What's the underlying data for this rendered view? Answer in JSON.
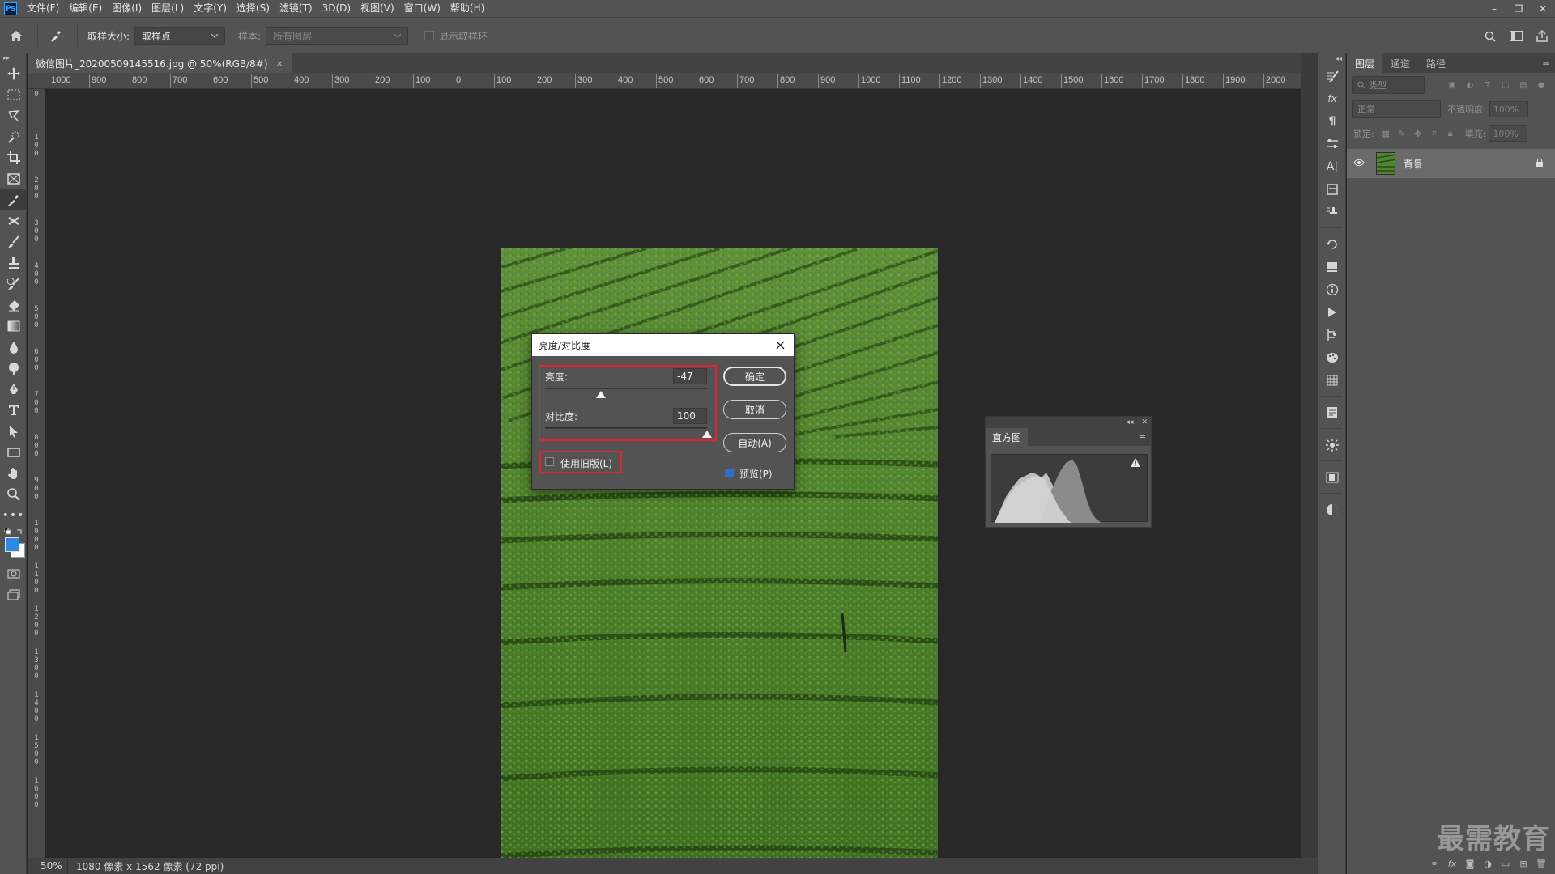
{
  "menubar": {
    "logo": "Ps",
    "items": [
      "文件(F)",
      "编辑(E)",
      "图像(I)",
      "图层(L)",
      "文字(Y)",
      "选择(S)",
      "滤镜(T)",
      "3D(D)",
      "视图(V)",
      "窗口(W)",
      "帮助(H)"
    ],
    "window_controls": [
      "–",
      "❐",
      "✕"
    ]
  },
  "options": {
    "sample_size_label": "取样大小:",
    "sample_size_value": "取样点",
    "sample_label": "样本:",
    "sample_value": "所有图层",
    "show_ring_label": "显示取样环"
  },
  "document": {
    "tab_title": "微信图片_20200509145516.jpg @ 50%(RGB/8#)",
    "tab_close": "×"
  },
  "ruler": {
    "top": [
      "1000",
      "900",
      "800",
      "700",
      "600",
      "500",
      "400",
      "300",
      "200",
      "100",
      "0",
      "100",
      "200",
      "300",
      "400",
      "500",
      "600",
      "700",
      "800",
      "900",
      "1000",
      "1100",
      "1200",
      "1300",
      "1400",
      "1500",
      "1600",
      "1700",
      "1800",
      "1900",
      "2000"
    ],
    "left": [
      "0",
      "1 0 0",
      "2 0 0",
      "3 0 0",
      "4 0 0",
      "5 0 0",
      "6 0 0",
      "7 0 0",
      "8 0 0",
      "9 0 0",
      "1 0 0 0",
      "1 1 0 0",
      "1 2 0 0",
      "1 3 0 0",
      "1 4 0 0",
      "1 5 0 0",
      "1 6 0 0"
    ]
  },
  "status": {
    "zoom": "50%",
    "info": "1080 像素 x 1562 像素 (72 ppi)"
  },
  "dialog": {
    "title": "亮度/对比度",
    "brightness_label": "亮度:",
    "brightness_value": "-47",
    "brightness_level": -47,
    "contrast_label": "对比度:",
    "contrast_value": "100",
    "contrast_level": 100,
    "legacy_label": "使用旧版(L)",
    "ok_label": "确定",
    "cancel_label": "取消",
    "auto_label": "自动(A)",
    "preview_label": "预览(P)",
    "legacy_checked": false,
    "preview_checked": true
  },
  "histogram": {
    "tab_label": "直方图",
    "warning_icon": "!"
  },
  "layers": {
    "tabs": [
      "图层",
      "通道",
      "路径"
    ],
    "kind_placeholder": "类型",
    "blend_mode": "正常",
    "opacity_label": "不透明度:",
    "opacity_value": "100%",
    "lock_label": "锁定:",
    "fill_label": "填充:",
    "fill_value": "100%",
    "layer_name": "背景"
  },
  "watermark": "最需教育",
  "colors": {
    "accent": "#2d8ae0",
    "highlight_box": "#e0232c",
    "panel_bg": "#535353",
    "canvas_bg": "#282828"
  }
}
